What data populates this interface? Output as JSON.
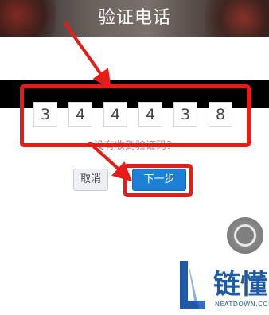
{
  "header": {
    "title": "验证电话"
  },
  "verification": {
    "digits": [
      "3",
      "4",
      "4",
      "4",
      "3",
      "8"
    ],
    "resend_prompt": "没有收到验证码？"
  },
  "actions": {
    "cancel_label": "取消",
    "next_label": "下一步"
  },
  "watermark": {
    "name": "链懂",
    "url": "NEATDOWN.COM"
  },
  "colors": {
    "annotation_red": "#e51c17",
    "primary_button": "#1d7fd6",
    "watermark_blue": "#1e5aa8"
  }
}
